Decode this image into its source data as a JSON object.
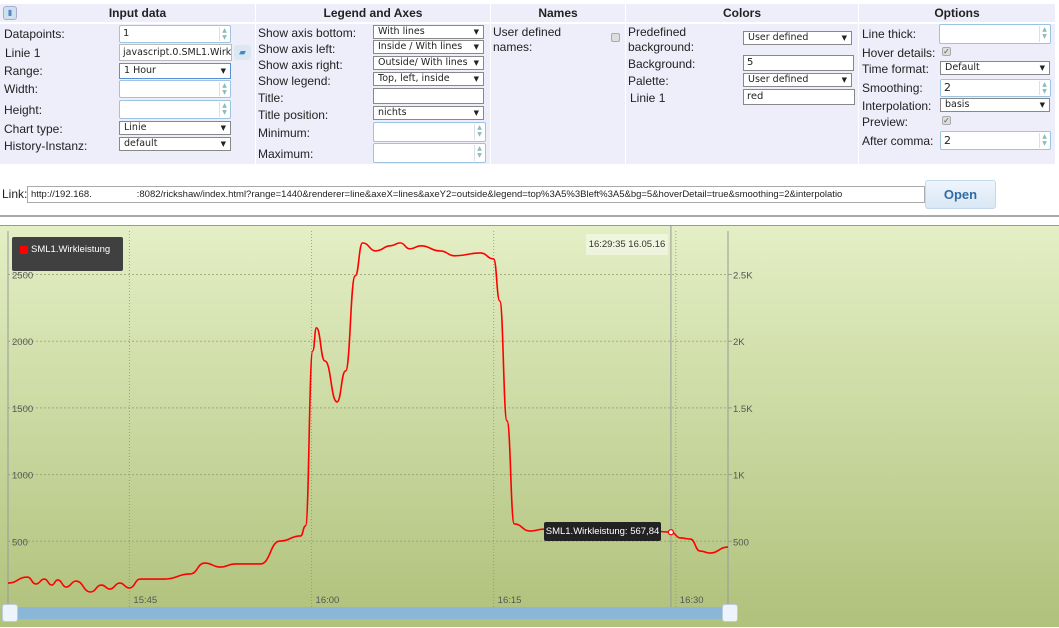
{
  "toolbar": {
    "trash_icon": "trash-icon"
  },
  "input_data": {
    "title": "Input data",
    "datapoints_label": "Datapoints:",
    "datapoints_value": "1",
    "line1_label": "Linie 1",
    "line1_value": "javascript.0.SML1.Wirkl",
    "range_label": "Range:",
    "range_value": "1 Hour",
    "width_label": "Width:",
    "width_value": "",
    "height_label": "Height:",
    "height_value": "",
    "chart_type_label": "Chart type:",
    "chart_type_value": "Linie",
    "history_label": "History-Instanz:",
    "history_value": "default"
  },
  "legend_axes": {
    "title": "Legend and Axes",
    "axis_bottom_label": "Show axis bottom:",
    "axis_bottom_value": "With lines",
    "axis_left_label": "Show axis left:",
    "axis_left_value": "Inside / With lines",
    "axis_right_label": "Show axis right:",
    "axis_right_value": "Outside/ With lines",
    "legend_label": "Show legend:",
    "legend_value": "Top, left, inside",
    "title_label": "Title:",
    "title_value": "",
    "title_pos_label": "Title position:",
    "title_pos_value": "nichts",
    "min_label": "Minimum:",
    "min_value": "",
    "max_label": "Maximum:",
    "max_value": ""
  },
  "names": {
    "title": "Names",
    "user_defined_label_1": "User defined",
    "user_defined_label_2": "names:",
    "user_defined_checked": false
  },
  "colors": {
    "title": "Colors",
    "predef_label_1": "Predefined",
    "predef_label_2": "background:",
    "predef_value": "User defined",
    "bg_label": "Background:",
    "bg_value": "5",
    "palette_label": "Palette:",
    "palette_value": "User defined",
    "line1_label": "Linie 1",
    "line1_value": "red"
  },
  "options": {
    "title": "Options",
    "line_thick_label": "Line thick:",
    "line_thick_value": "",
    "hover_label": "Hover details:",
    "hover_checked": true,
    "time_format_label": "Time format:",
    "time_format_value": "Default",
    "smoothing_label": "Smoothing:",
    "smoothing_value": "2",
    "interp_label": "Interpolation:",
    "interp_value": "basis",
    "preview_label": "Preview:",
    "preview_checked": true,
    "after_comma_label": "After comma:",
    "after_comma_value": "2"
  },
  "link": {
    "label": "Link:",
    "value_start": "http://192.168.",
    "value_end": ":8082/rickshaw/index.html?range=1440&renderer=line&axeX=lines&axeY2=outside&legend=top%3A5%3Bleft%3A5&bg=5&hoverDetail=true&smoothing=2&interpolatio",
    "open_label": "Open"
  },
  "chart_data": {
    "type": "line",
    "title": "",
    "series": [
      {
        "name": "SML1.Wirkleistung",
        "color": "#ff0000",
        "x_minutes_after_1535": [
          0,
          1.6,
          2.3,
          3.0,
          3.6,
          4.1,
          4.8,
          5.6,
          6.8,
          7.7,
          8.4,
          9.2,
          10.0,
          10.9,
          12.9,
          15.0,
          16.2,
          17.5,
          18.7,
          20.8,
          22.4,
          24.1,
          24.5,
          25.1,
          25.4,
          26.1,
          27.1,
          27.8,
          28.6,
          29.2,
          30.3,
          31.5,
          32.3,
          33.1,
          34.0,
          35.6,
          36.8,
          38.9,
          40.0,
          40.5,
          41.1,
          41.7,
          43.0,
          44.2,
          48.8,
          52.1,
          54.6,
          55.4,
          56.2,
          57.0,
          57.8,
          59.3
        ],
        "values": [
          187,
          232,
          180,
          217,
          172,
          210,
          157,
          202,
          120,
          172,
          142,
          187,
          150,
          217,
          217,
          255,
          337,
          307,
          330,
          330,
          502,
          540,
          615,
          1927,
          2100,
          1852,
          1545,
          1777,
          2490,
          2737,
          2677,
          2715,
          2737,
          2692,
          2715,
          2677,
          2640,
          2662,
          2617,
          2302,
          1402,
          630,
          577,
          592,
          600,
          592,
          568,
          525,
          517,
          427,
          412,
          457
        ]
      }
    ],
    "x_ticks": [
      {
        "label": "15:45",
        "minute": 10
      },
      {
        "label": "16:00",
        "minute": 25
      },
      {
        "label": "16:15",
        "minute": 40
      },
      {
        "label": "16:30",
        "minute": 55
      }
    ],
    "x_range_minutes": [
      0,
      59.3
    ],
    "y_left_ticks": [
      "500",
      "1000",
      "1500",
      "2000",
      "2500"
    ],
    "y_right_ticks": [
      "500",
      "1K",
      "1.5K",
      "2K",
      "2.5K"
    ],
    "y_tick_values": [
      500,
      1000,
      1500,
      2000,
      2500
    ],
    "ylim": [
      0,
      2800
    ],
    "grid": true,
    "legend": {
      "placement": "top-left",
      "entry": "SML1.Wirkleistung"
    },
    "hover": {
      "time": "16:29:35 16.05.16",
      "label": "SML1.Wirkleistung: 567,84",
      "minute": 54.6,
      "value": 567.84
    }
  }
}
